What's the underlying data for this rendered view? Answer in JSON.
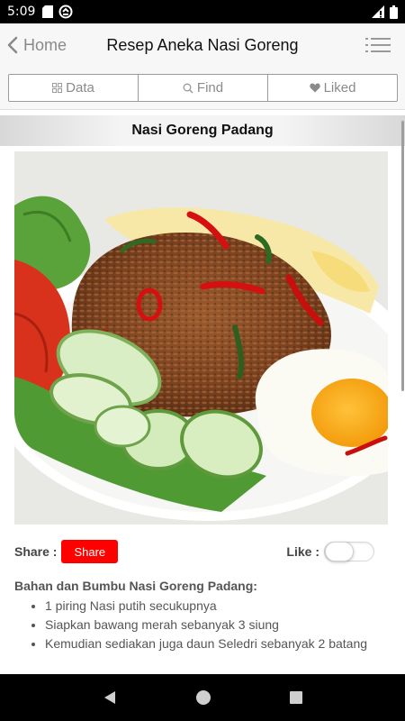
{
  "status_bar": {
    "time": "5:09",
    "left_icons": [
      "sd-card-icon",
      "sync-icon"
    ],
    "right_icons": [
      "signal-icon",
      "battery-icon"
    ]
  },
  "navbar": {
    "back_label": "Home",
    "title": "Resep Aneka Nasi Goreng",
    "menu_icon": "list-icon"
  },
  "tabs": [
    {
      "label": "Data",
      "icon": "grid-icon"
    },
    {
      "label": "Find",
      "icon": "search-icon"
    },
    {
      "label": "Liked",
      "icon": "heart-icon"
    }
  ],
  "recipe": {
    "title": "Nasi Goreng Padang",
    "share_label": "Share :",
    "share_button": "Share",
    "like_label": "Like :",
    "liked": false,
    "ingredients_heading": "Bahan dan Bumbu Nasi Goreng Padang:",
    "ingredients": [
      "1 piring Nasi putih secukupnya",
      "Siapkan bawang merah sebanyak 3 siung",
      "Kemudian sediakan juga daun Seledri sebanyak 2 batang"
    ]
  },
  "colors": {
    "accent_red": "#ff0000",
    "tab_text": "#8a8a8a"
  }
}
